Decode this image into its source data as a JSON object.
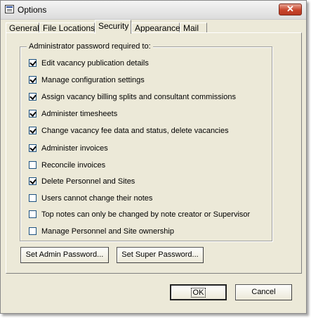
{
  "window": {
    "title": "Options",
    "icon": "app-window-icon",
    "close": "close-icon"
  },
  "tabs": [
    {
      "label": "General"
    },
    {
      "label": "File Locations"
    },
    {
      "label": "Security",
      "active": true
    },
    {
      "label": "Appearance"
    },
    {
      "label": "Mail"
    }
  ],
  "security": {
    "group_label": "Administrator password required to:",
    "options": [
      {
        "label": "Edit vacancy publication details",
        "checked": true
      },
      {
        "label": "Manage configuration settings",
        "checked": true
      },
      {
        "label": "Assign vacancy billing splits and consultant commissions",
        "checked": true
      },
      {
        "label": "Administer timesheets",
        "checked": true
      },
      {
        "label": "Change vacancy fee data and status, delete vacancies",
        "checked": true
      },
      {
        "label": "Administer invoices",
        "checked": true
      },
      {
        "label": "Reconcile invoices",
        "checked": false
      },
      {
        "label": "Delete Personnel and Sites",
        "checked": true
      },
      {
        "label": "Users cannot change their notes",
        "checked": false
      },
      {
        "label": "Top notes can only be changed by note creator or Supervisor",
        "checked": false
      },
      {
        "label": "Manage Personnel and Site ownership",
        "checked": false
      }
    ],
    "set_admin_password": "Set Admin Password...",
    "set_super_password": "Set Super Password..."
  },
  "footer": {
    "ok": "OK",
    "cancel": "Cancel"
  }
}
